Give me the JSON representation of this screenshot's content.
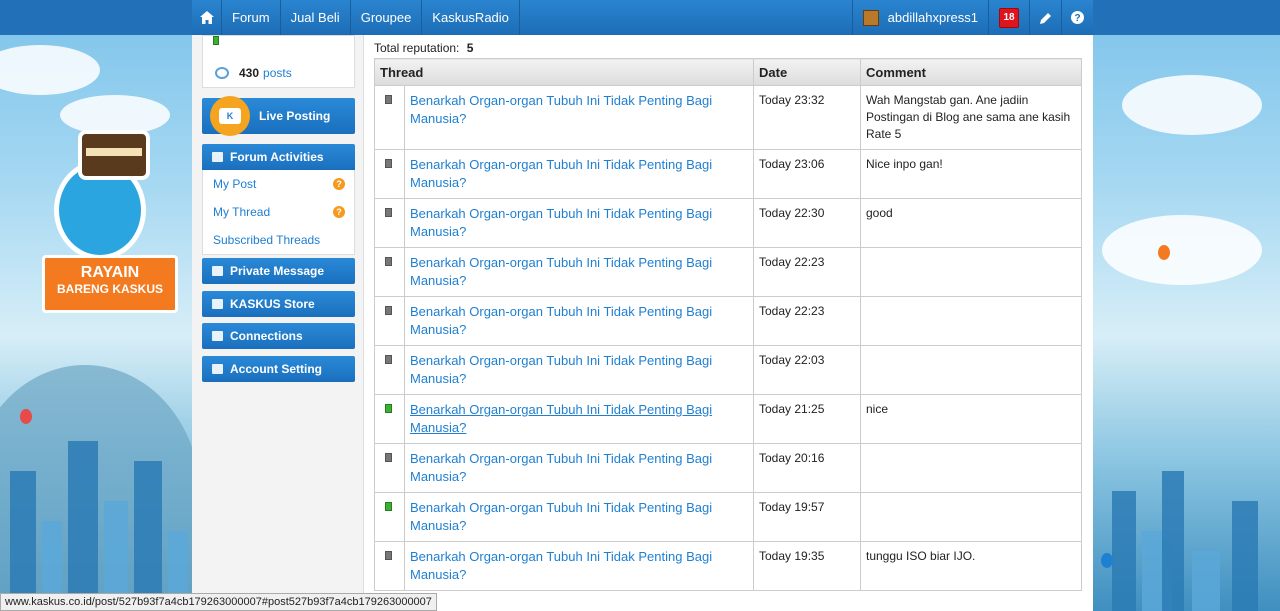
{
  "nav": {
    "home_icon": "home-icon",
    "items": [
      "Forum",
      "Jual Beli",
      "Groupee",
      "KaskusRadio"
    ],
    "username": "abdillahxpress1",
    "notification_count": "18",
    "pencil_icon": "pencil-icon",
    "help_icon": "help-icon"
  },
  "banner": {
    "line1": "RAYAIN",
    "line2": "BARENG KASKUS"
  },
  "sidebar": {
    "posts_count": "430",
    "posts_word": "posts",
    "live_posting": "Live Posting",
    "forum_activities": "Forum Activities",
    "menu": [
      {
        "label": "My Post",
        "badge": "?"
      },
      {
        "label": "My Thread",
        "badge": "?"
      },
      {
        "label": "Subscribed Threads",
        "badge": ""
      }
    ],
    "private_message": "Private Message",
    "kaskus_store": "KASKUS Store",
    "connections": "Connections",
    "account_setting": "Account Setting"
  },
  "reputation": {
    "total_label": "Total reputation:",
    "total_value": "5",
    "columns": [
      "Thread",
      "Date",
      "Comment"
    ],
    "rows": [
      {
        "status": "gray",
        "thread": "Benarkah Organ-organ Tubuh Ini Tidak Penting Bagi Manusia?",
        "date": "Today 23:32",
        "comment": "Wah Mangstab gan. Ane jadiin Postingan di Blog ane sama ane kasih Rate 5"
      },
      {
        "status": "gray",
        "thread": "Benarkah Organ-organ Tubuh Ini Tidak Penting Bagi Manusia?",
        "date": "Today 23:06",
        "comment": "Nice inpo gan!"
      },
      {
        "status": "gray",
        "thread": "Benarkah Organ-organ Tubuh Ini Tidak Penting Bagi Manusia?",
        "date": "Today 22:30",
        "comment": "good"
      },
      {
        "status": "gray",
        "thread": "Benarkah Organ-organ Tubuh Ini Tidak Penting Bagi Manusia?",
        "date": "Today 22:23",
        "comment": ""
      },
      {
        "status": "gray",
        "thread": "Benarkah Organ-organ Tubuh Ini Tidak Penting Bagi Manusia?",
        "date": "Today 22:23",
        "comment": ""
      },
      {
        "status": "gray",
        "thread": "Benarkah Organ-organ Tubuh Ini Tidak Penting Bagi Manusia?",
        "date": "Today 22:03",
        "comment": ""
      },
      {
        "status": "green",
        "thread": "Benarkah Organ-organ Tubuh Ini Tidak Penting Bagi Manusia?",
        "date": "Today 21:25",
        "comment": "nice",
        "hovered": true
      },
      {
        "status": "gray",
        "thread": "Benarkah Organ-organ Tubuh Ini Tidak Penting Bagi Manusia?",
        "date": "Today 20:16",
        "comment": ""
      },
      {
        "status": "green",
        "thread": "Benarkah Organ-organ Tubuh Ini Tidak Penting Bagi Manusia?",
        "date": "Today 19:57",
        "comment": ""
      },
      {
        "status": "gray",
        "thread": "Benarkah Organ-organ Tubuh Ini Tidak Penting Bagi Manusia?",
        "date": "Today 19:35",
        "comment": "tunggu ISO biar IJO."
      }
    ]
  },
  "statusbar": {
    "url": "www.kaskus.co.id/post/527b93f7a4cb179263000007#post527b93f7a4cb179263000007"
  },
  "colors": {
    "nav_blue": "#2271b8",
    "link_blue": "#1f7fd1",
    "badge_red": "#e0141c",
    "badge_orange": "#f59a1d",
    "status_green": "#3cb030",
    "status_gray": "#777777"
  }
}
